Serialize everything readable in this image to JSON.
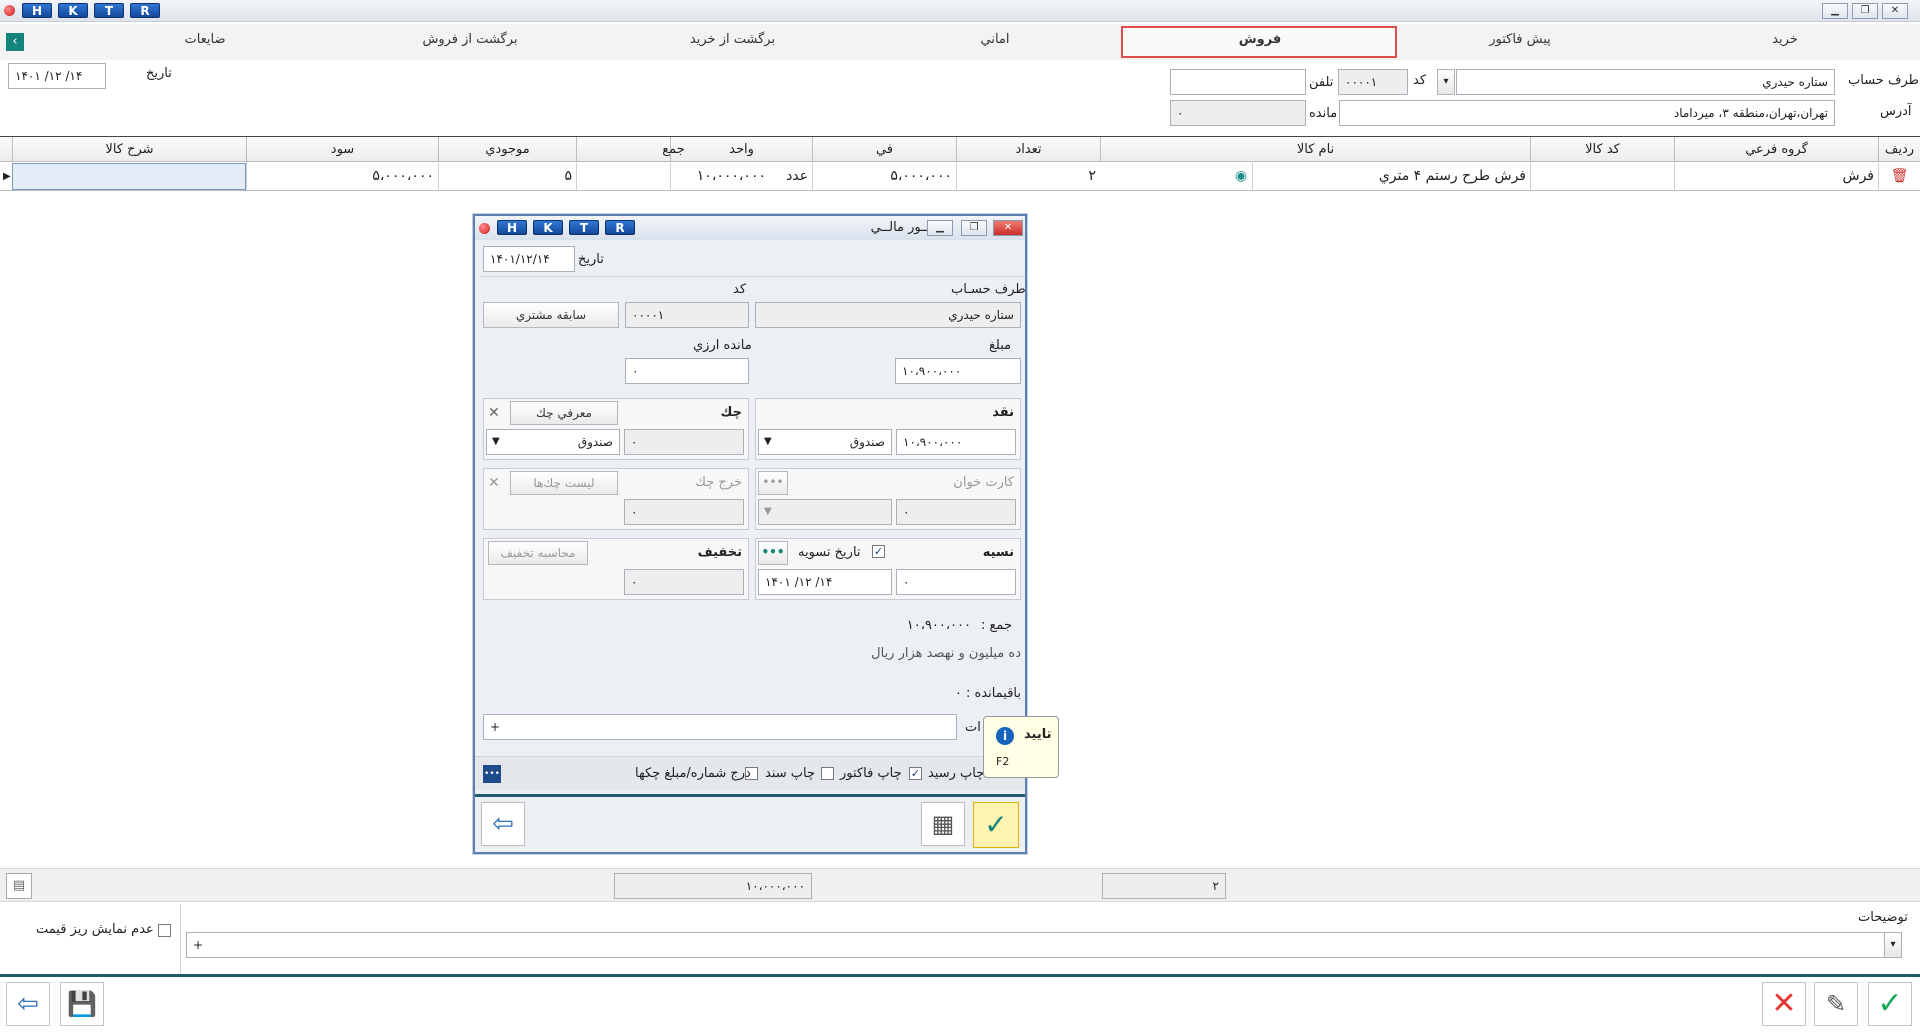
{
  "titlebar": {
    "hk": [
      "H",
      "K",
      "T",
      "R"
    ]
  },
  "tabs": [
    {
      "key": "buy",
      "label": "خريد"
    },
    {
      "key": "proforma",
      "label": "پيش فاكتور"
    },
    {
      "key": "sell",
      "label": "فروش"
    },
    {
      "key": "trust",
      "label": "اماني"
    },
    {
      "key": "return_buy",
      "label": "برگشت از خريد"
    },
    {
      "key": "return_sell",
      "label": "برگشت از فروش"
    },
    {
      "key": "waste",
      "label": "ضايعات"
    }
  ],
  "header": {
    "account_label": "طرف حساب",
    "account_value": "ستاره حيدري",
    "code_label": "كد",
    "code_value": "۰۰۰۰۱",
    "phone_label": "تلفن",
    "phone_value": "",
    "address_label": "آدرس",
    "address_value": "تهران،تهران،منطقه ۳، ميرداماد",
    "balance_label": "مانده",
    "balance_value": "۰",
    "date_label": "تاريخ",
    "date_value": "۱۴۰۱ /۱۲ /۱۴"
  },
  "grid": {
    "columns": [
      "رديف",
      "گروه فرعي",
      "كد كالا",
      "نام كالا",
      "تعداد",
      "في",
      "واحد",
      "جمع",
      "موجودي",
      "سود",
      "شرح كالا"
    ],
    "rows": [
      {
        "group": "فرش",
        "code": "",
        "name": "فرش طرح رستم ۴ متري",
        "qty": "۲",
        "price": "۵،۰۰۰،۰۰۰",
        "unit": "عدد",
        "total": "۱۰،۰۰۰،۰۰۰",
        "stock": "۵",
        "profit": "۵،۰۰۰،۰۰۰",
        "desc": ""
      }
    ]
  },
  "dialog": {
    "title": "امــور مالــي",
    "hk": [
      "H",
      "K",
      "T",
      "R"
    ],
    "date_label": "تاريخ",
    "date_value": "۱۴۰۱/۱۲/۱۴",
    "account_label": "طرف حسـاب",
    "account_value": "ستاره حيدري",
    "code_label": "كد",
    "code_value": "۰۰۰۰۱",
    "history_button": "سابقه مشتري",
    "amount_label": "مبلغ",
    "amount_value": "۱۰،۹۰۰،۰۰۰",
    "fx_balance_label": "مانده ارزي",
    "fx_balance_value": "۰",
    "cash_label": "نقد",
    "cash_value": "۱۰،۹۰۰،۰۰۰",
    "cash_box": "صندوق",
    "cheque_label": "چك",
    "cheque_intro_button": "معرفي چك",
    "cheque_value": "۰",
    "cheque_box": "صندوق",
    "cardreader_label": "كارت خوان",
    "cardreader_value": "۰",
    "spend_cheque_label": "خرج چك",
    "cheque_list_button": "ليست چك‌ها",
    "spend_cheque_value": "۰",
    "credit_label": "نسيه",
    "credit_value": "۰",
    "settle_date_label": "تاريخ تسويه",
    "settle_date_value": "۱۴۰۱ /۱۲ /۱۴",
    "discount_label": "تخفيف",
    "discount_calc_button": "محاسبه تخفيف",
    "discount_value": "۰",
    "sum_label": "جمع :",
    "sum_value": "۱۰،۹۰۰،۰۰۰",
    "sum_words": "ده ميليون  و نهصد هزار  ريال",
    "remain_label": "باقيمانده : ۰",
    "notes_label": "ات",
    "notes_value": "+",
    "opt_print_receipt": "چاپ رسيد",
    "opt_print_invoice": "چاپ فاكتور",
    "opt_print_doc": "چاپ سند",
    "opt_insert_cheque": "درج شماره/مبلغ چكها",
    "tooltip_title": "تاييد",
    "tooltip_key": "F2"
  },
  "totals": {
    "sum": "۱۰،۰۰۰،۰۰۰",
    "qty": "۲"
  },
  "bottom": {
    "notes_label": "توضيحات",
    "notes_value": "+",
    "hide_price_label": "عدم نمايش ريز قيمت"
  },
  "colors": {
    "accent": "#1565c0",
    "tab_highlight": "#e04c4c",
    "confirm": "#1aa85a",
    "cancel": "#e53935"
  }
}
